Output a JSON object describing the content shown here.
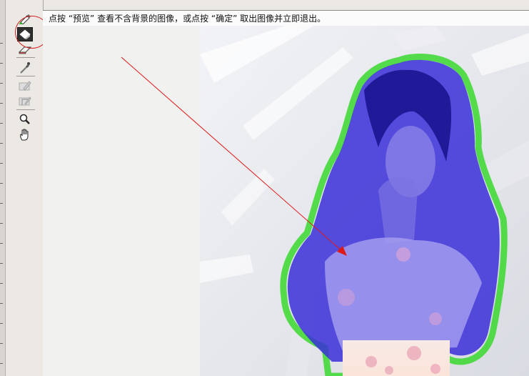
{
  "instruction": {
    "text": "点按 “预览” 查看不含背景的图像，或点按 “确定” 取出图像并立即退出。"
  },
  "toolbox": {
    "tools": [
      {
        "icon": "edge-highlighter-icon",
        "active": false
      },
      {
        "icon": "fill-tool-icon",
        "active": true
      },
      {
        "icon": "eraser-icon",
        "active": false
      },
      {
        "icon": "eyedropper-icon",
        "active": false
      },
      {
        "icon": "cleanup-tool-icon",
        "active": false
      },
      {
        "icon": "edge-touchup-tool-icon",
        "active": false
      },
      {
        "icon": "zoom-icon",
        "active": false
      },
      {
        "icon": "hand-icon",
        "active": false
      }
    ]
  },
  "colors": {
    "highlight_circle": "#d22020",
    "arrow": "#e01818",
    "fill_overlay": "#3a2fd8",
    "edge_highlight": "#3ad82e"
  }
}
